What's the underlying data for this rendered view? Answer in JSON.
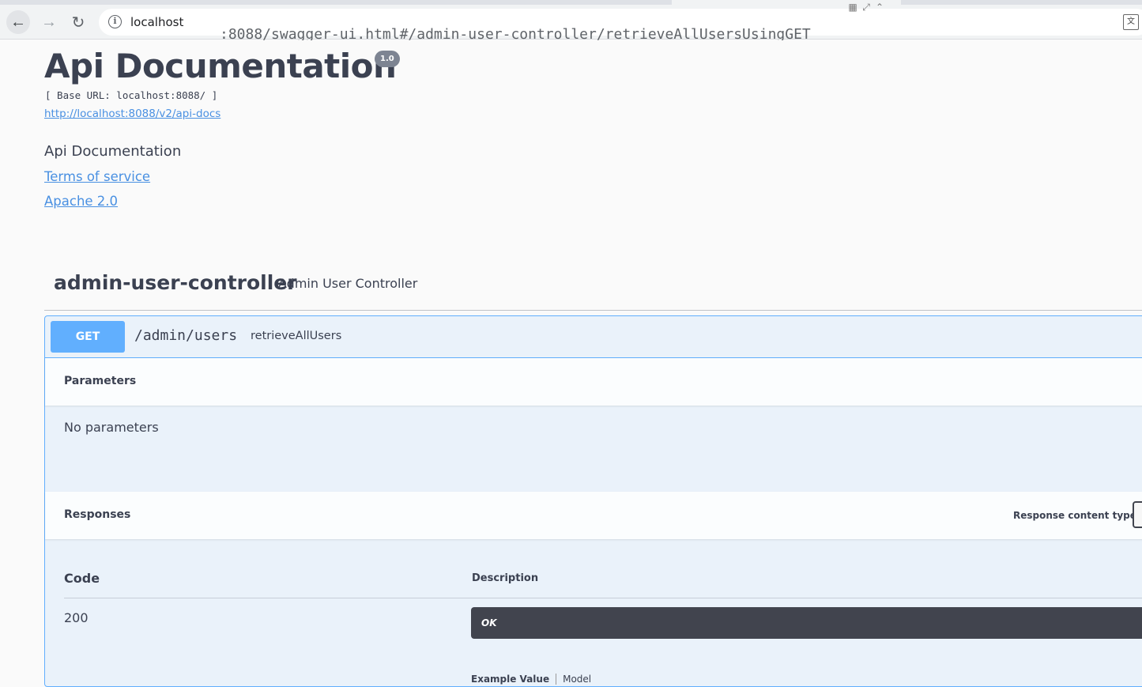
{
  "browser": {
    "url_host": "localhost",
    "url_path": ":8088/swagger-ui.html#/admin-user-controller/retrieveAllUsersUsingGET",
    "info_glyph": "i",
    "translate_glyph": "文"
  },
  "info": {
    "title": "Api Documentation",
    "version": "1.0",
    "base_url": "[ Base URL: localhost:8088/ ]",
    "api_docs_link": "http://localhost:8088/v2/api-docs",
    "description": "Api Documentation",
    "terms_link": "Terms of service",
    "license_link": "Apache 2.0"
  },
  "tag": {
    "name": "admin-user-controller",
    "description": "Admin User Controller"
  },
  "operation": {
    "method": "GET",
    "path": "/admin/users",
    "summary": "retrieveAllUsers",
    "parameters_title": "Parameters",
    "no_parameters": "No parameters",
    "responses_title": "Responses",
    "response_content_type_label": "Response content type",
    "columns": {
      "code": "Code",
      "description": "Description"
    },
    "responses": [
      {
        "code": "200",
        "description": "OK"
      }
    ],
    "tabs_peek": {
      "example": "Example Value",
      "model": "Model"
    }
  },
  "colors": {
    "get": "#61affe",
    "text": "#3b4151",
    "link": "#4990e2",
    "dark_box": "#41444e"
  }
}
